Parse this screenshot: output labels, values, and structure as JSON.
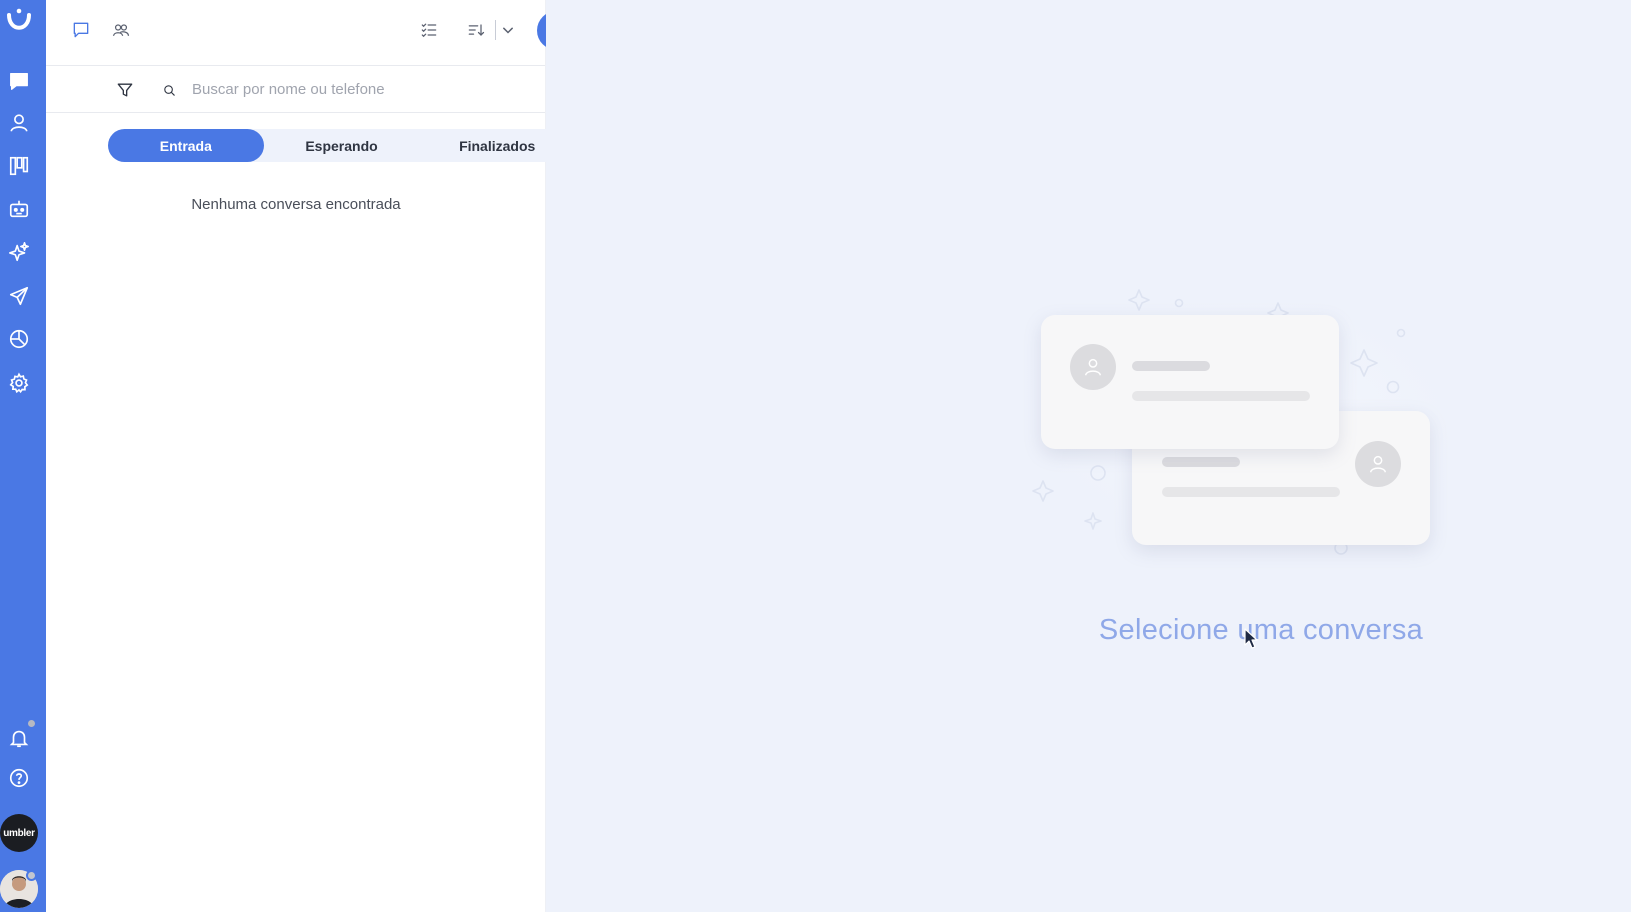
{
  "sidebar": {
    "logo": "umbler-logo",
    "nav": [
      {
        "name": "conversations",
        "icon": "chat-icon"
      },
      {
        "name": "contacts",
        "icon": "user-icon"
      },
      {
        "name": "kanban",
        "icon": "board-icon"
      },
      {
        "name": "bots",
        "icon": "robot-icon"
      },
      {
        "name": "ai",
        "icon": "sparkles-icon"
      },
      {
        "name": "campaigns",
        "icon": "send-icon"
      },
      {
        "name": "reports",
        "icon": "pie-chart-icon"
      },
      {
        "name": "settings",
        "icon": "gear-icon"
      }
    ],
    "bottom": [
      {
        "name": "notifications",
        "icon": "bell-icon"
      },
      {
        "name": "help",
        "icon": "help-icon"
      }
    ],
    "brand_avatar_text": "umbler"
  },
  "panel": {
    "search_placeholder": "Buscar por nome ou telefone",
    "tabs": [
      {
        "label": "Entrada",
        "active": true
      },
      {
        "label": "Esperando",
        "active": false
      },
      {
        "label": "Finalizados",
        "active": false
      }
    ],
    "empty_message": "Nenhuma conversa encontrada"
  },
  "main": {
    "empty_state": "Selecione uma conversa"
  },
  "colors": {
    "accent": "#4a78e4",
    "background": "#eef2fb",
    "empty_state_text": "#8fa8e8"
  }
}
